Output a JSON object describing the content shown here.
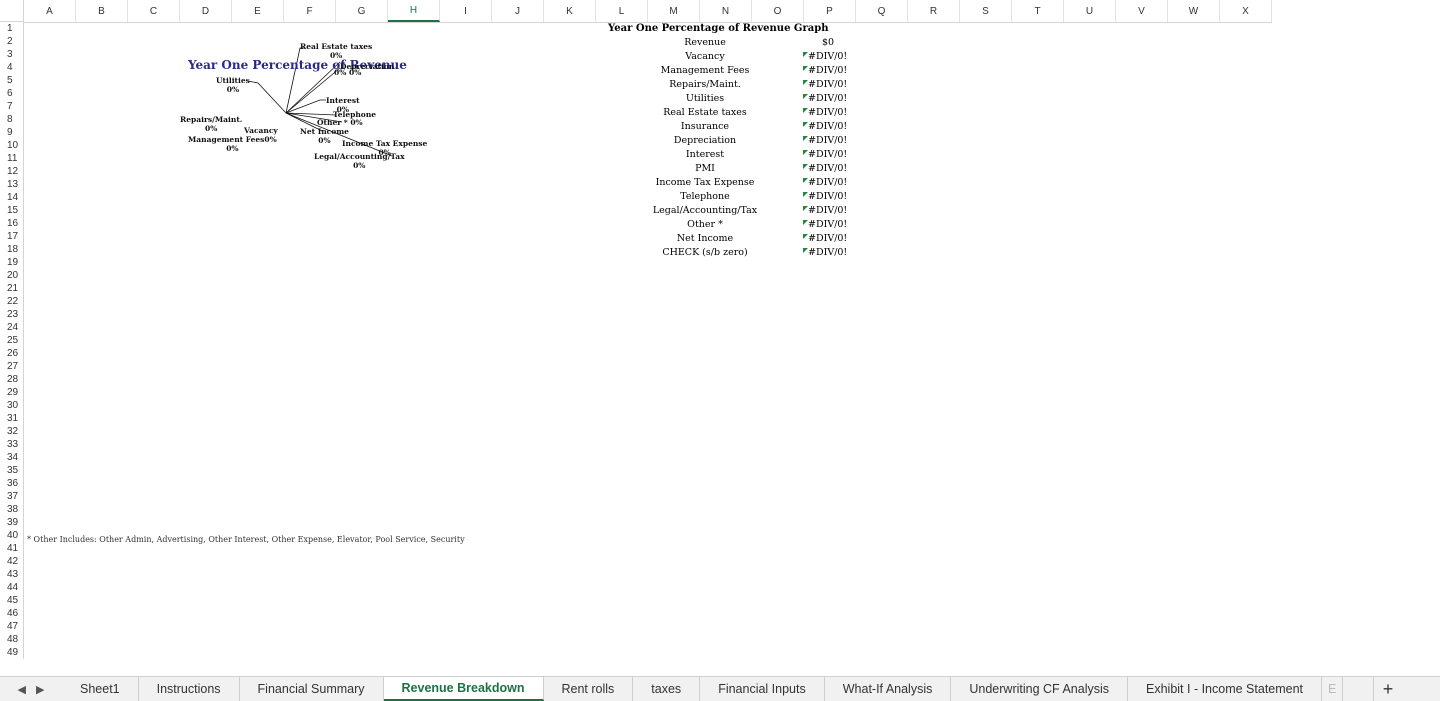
{
  "columns": [
    "A",
    "B",
    "C",
    "D",
    "E",
    "F",
    "G",
    "H",
    "I",
    "J",
    "K",
    "L",
    "M",
    "N",
    "O",
    "P",
    "Q",
    "R",
    "S",
    "T",
    "U",
    "V",
    "W",
    "X"
  ],
  "selected_column": "H",
  "rows": [
    "1",
    "2",
    "3",
    "4",
    "5",
    "6",
    "7",
    "8",
    "9",
    "10",
    "11",
    "12",
    "13",
    "14",
    "15",
    "16",
    "17",
    "18",
    "19",
    "20",
    "21",
    "22",
    "23",
    "24",
    "25",
    "26",
    "27",
    "28",
    "29",
    "30",
    "31",
    "32",
    "33",
    "34",
    "35",
    "36",
    "37",
    "38",
    "39",
    "40",
    "41",
    "42",
    "43",
    "44",
    "45",
    "46",
    "47",
    "48",
    "49"
  ],
  "chart": {
    "title": "Year One Percentage of Revenue",
    "labels": [
      {
        "name": "Real Estate taxes",
        "value": "0%"
      },
      {
        "name": "Depreciation",
        "value": "0%"
      },
      {
        "name": "Insurance",
        "value": "0%"
      },
      {
        "name": "Utilities",
        "value": "0%"
      },
      {
        "name": "Interest",
        "value": "0%"
      },
      {
        "name": "Telephone",
        "value": ""
      },
      {
        "name": "Other *",
        "value": "0%"
      },
      {
        "name": "Repairs/Maint.",
        "value": "0%"
      },
      {
        "name": "Vacancy",
        "value": ""
      },
      {
        "name": "Net Income",
        "value": "0%"
      },
      {
        "name": "Management Fees",
        "value": "0%"
      },
      {
        "name": "Income Tax Expense",
        "value": "0%"
      },
      {
        "name": "Legal/Accounting/Tax",
        "value": "0%"
      },
      {
        "name": "PMI",
        "value": "0%"
      }
    ]
  },
  "table": {
    "title": "Year One Percentage of Revenue Graph",
    "rows": [
      {
        "label": "Revenue",
        "value": "$0",
        "flag": false
      },
      {
        "label": "Vacancy",
        "value": "#DIV/0!",
        "flag": true
      },
      {
        "label": "Management Fees",
        "value": "#DIV/0!",
        "flag": true
      },
      {
        "label": "Repairs/Maint.",
        "value": "#DIV/0!",
        "flag": true
      },
      {
        "label": "Utilities",
        "value": "#DIV/0!",
        "flag": true
      },
      {
        "label": "Real Estate taxes",
        "value": "#DIV/0!",
        "flag": true
      },
      {
        "label": "Insurance",
        "value": "#DIV/0!",
        "flag": true
      },
      {
        "label": "Depreciation",
        "value": "#DIV/0!",
        "flag": true
      },
      {
        "label": "Interest",
        "value": "#DIV/0!",
        "flag": true
      },
      {
        "label": "PMI",
        "value": "#DIV/0!",
        "flag": true
      },
      {
        "label": "Income Tax Expense",
        "value": "#DIV/0!",
        "flag": true
      },
      {
        "label": "Telephone",
        "value": "#DIV/0!",
        "flag": true
      },
      {
        "label": "Legal/Accounting/Tax",
        "value": "#DIV/0!",
        "flag": true
      },
      {
        "label": "Other *",
        "value": "#DIV/0!",
        "flag": true
      },
      {
        "label": "Net Income",
        "value": "#DIV/0!",
        "flag": true
      },
      {
        "label": "CHECK (s/b zero)",
        "value": "#DIV/0!",
        "flag": true
      }
    ]
  },
  "note": "* Other Includes: Other Admin, Advertising, Other Interest, Other Expense, Elevator, Pool Service, Security",
  "tabs": [
    {
      "label": "Sheet1",
      "active": false
    },
    {
      "label": "Instructions",
      "active": false
    },
    {
      "label": "Financial Summary",
      "active": false
    },
    {
      "label": "Revenue Breakdown",
      "active": true
    },
    {
      "label": "Rent rolls",
      "active": false
    },
    {
      "label": "taxes",
      "active": false
    },
    {
      "label": "Financial Inputs",
      "active": false
    },
    {
      "label": "What-If Analysis",
      "active": false
    },
    {
      "label": "Underwriting CF Analysis",
      "active": false
    },
    {
      "label": "Exhibit I - Income Statement",
      "active": false
    },
    {
      "label": "E",
      "active": false
    }
  ],
  "add_sheet": "+",
  "nav_prev": "◀",
  "nav_next": "▶",
  "accent_color": "#1e7145"
}
